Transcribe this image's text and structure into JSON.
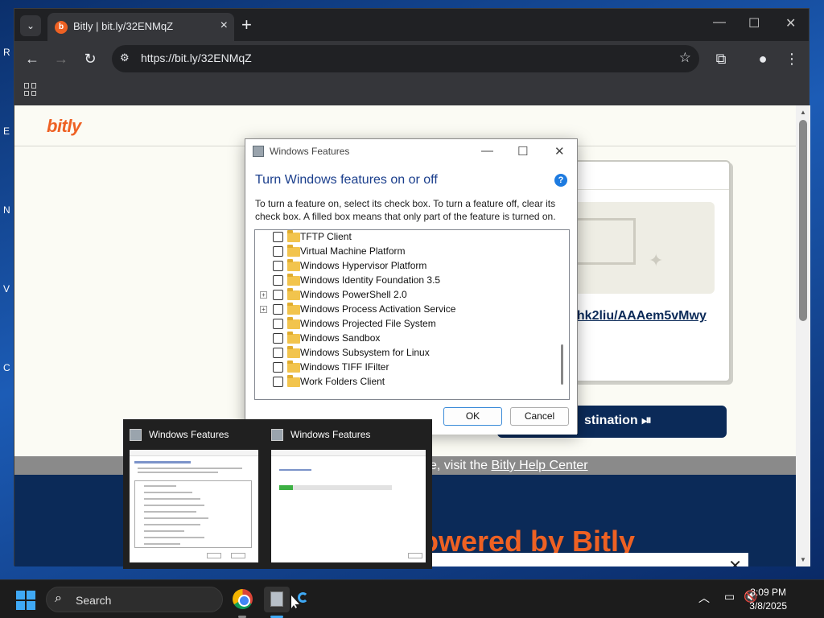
{
  "desktop": {
    "edge_letters": [
      "R",
      "E",
      "N",
      "V",
      "C"
    ]
  },
  "browser": {
    "tab": {
      "title": "Bitly | bit.ly/32ENMqZ",
      "favicon": "b"
    },
    "url": "https://bit.ly/32ENMqZ"
  },
  "page": {
    "logo": "bitly",
    "card_link": "xhk2liu/AAAem5vMwy",
    "destination_button": "stination ⏯",
    "help_prefix": "e, visit the ",
    "help_link": "Bitly Help Center",
    "footer_text": "owered by Bitly"
  },
  "dialog": {
    "title": "Windows Features",
    "heading": "Turn Windows features on or off",
    "help": "?",
    "description": "To turn a feature on, select its check box. To turn a feature off, clear its check box. A filled box means that only part of the feature is turned on.",
    "features": [
      {
        "label": "TFTP Client",
        "expandable": false
      },
      {
        "label": "Virtual Machine Platform",
        "expandable": false
      },
      {
        "label": "Windows Hypervisor Platform",
        "expandable": false
      },
      {
        "label": "Windows Identity Foundation 3.5",
        "expandable": false
      },
      {
        "label": "Windows PowerShell 2.0",
        "expandable": true
      },
      {
        "label": "Windows Process Activation Service",
        "expandable": true
      },
      {
        "label": "Windows Projected File System",
        "expandable": false
      },
      {
        "label": "Windows Sandbox",
        "expandable": false
      },
      {
        "label": "Windows Subsystem for Linux",
        "expandable": false
      },
      {
        "label": "Windows TIFF IFilter",
        "expandable": false
      },
      {
        "label": "Work Folders Client",
        "expandable": false
      }
    ],
    "ok": "OK",
    "cancel": "Cancel"
  },
  "thumbnails": [
    {
      "title": "Windows Features"
    },
    {
      "title": "Windows Features"
    }
  ],
  "taskbar": {
    "search_placeholder": "Search",
    "time": "3:09 PM",
    "date": "3/8/2025"
  },
  "colors": {
    "bitly_orange": "#ee6123",
    "bitly_navy": "#0b2a58",
    "windows_blue": "#3fa9f5",
    "dialog_heading": "#1a3e8c"
  }
}
